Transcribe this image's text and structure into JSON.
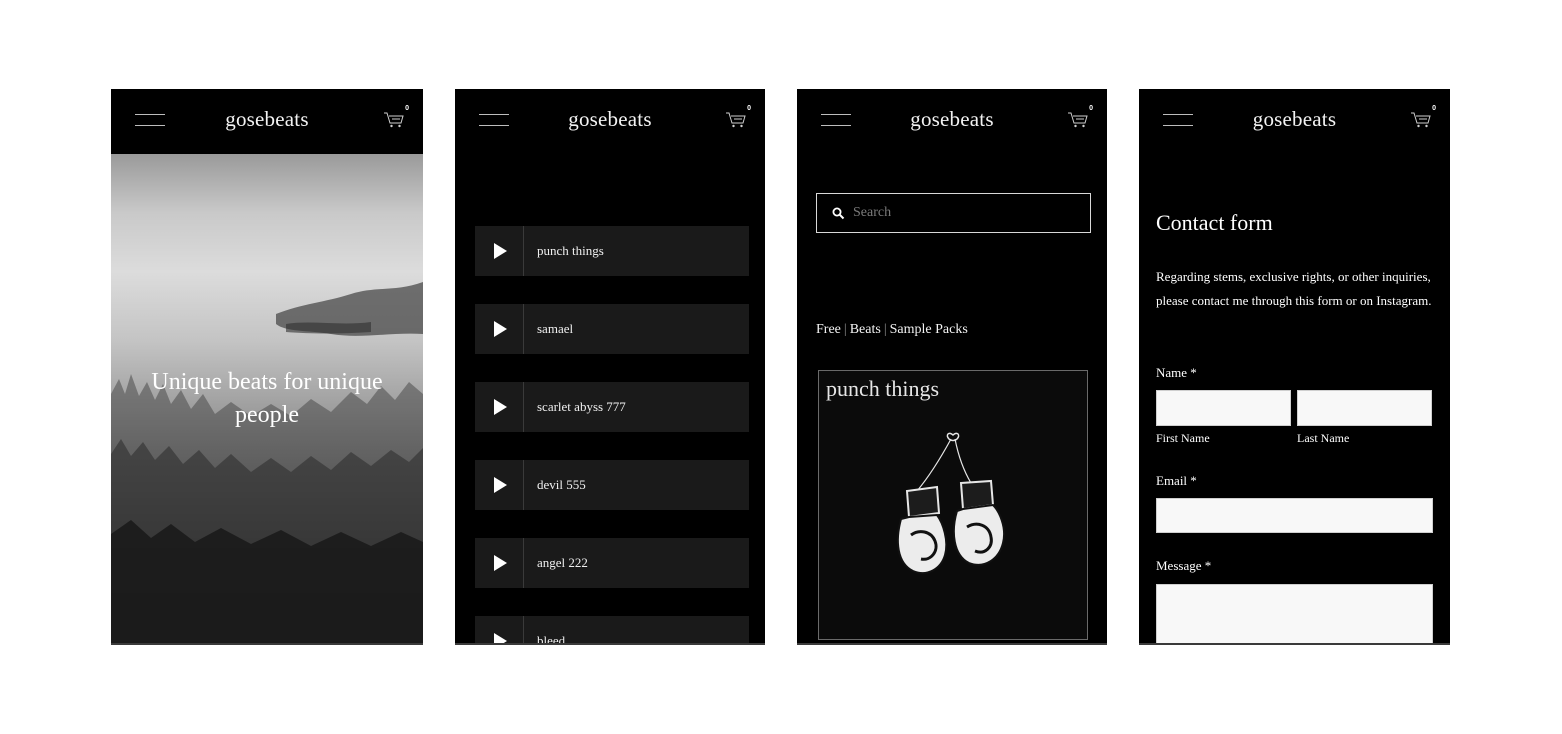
{
  "site": {
    "logo": "gosebeats",
    "cart_count": "0"
  },
  "home": {
    "headline": "Unique beats for unique people"
  },
  "tracks": [
    {
      "name": "punch things"
    },
    {
      "name": "samael"
    },
    {
      "name": "scarlet abyss 777"
    },
    {
      "name": "devil 555"
    },
    {
      "name": "angel 222"
    },
    {
      "name": "bleed"
    }
  ],
  "store": {
    "search_placeholder": "Search",
    "categories": [
      "Free",
      "Beats",
      "Sample Packs"
    ],
    "separator": "|",
    "product": {
      "title": "punch things"
    }
  },
  "contact": {
    "title": "Contact form",
    "description": "Regarding stems, exclusive rights, or other inquiries, please contact me through this form or on Instagram.",
    "name_label": "Name *",
    "first_name_label": "First Name",
    "last_name_label": "Last Name",
    "email_label": "Email *",
    "message_label": "Message *"
  },
  "colors": {
    "background": "#000000",
    "panel": "#1a1a1a",
    "text": "#ffffff",
    "page": "#ffffff"
  },
  "icons": {
    "menu": "hamburger-icon",
    "cart": "cart-icon",
    "play": "play-icon",
    "search": "search-icon"
  }
}
